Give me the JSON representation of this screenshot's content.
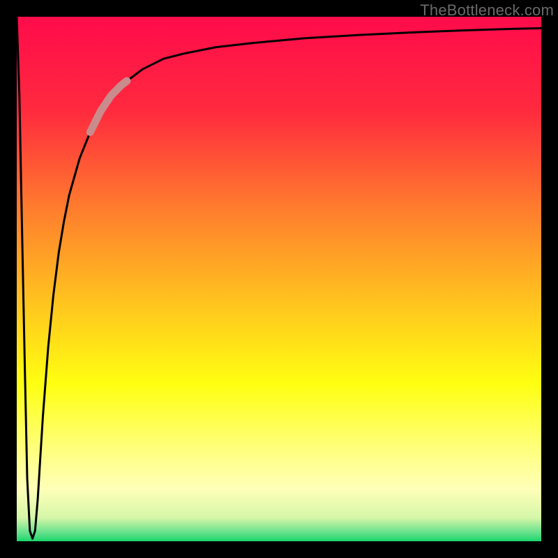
{
  "attribution": "TheBottleneck.com",
  "colors": {
    "frame": "#000000",
    "curve": "#000000",
    "highlight": "#c98b8b",
    "gradient_stops": [
      {
        "offset": 0.0,
        "color": "#ff0b4b"
      },
      {
        "offset": 0.18,
        "color": "#ff2a3e"
      },
      {
        "offset": 0.36,
        "color": "#ff7a2e"
      },
      {
        "offset": 0.54,
        "color": "#ffc21f"
      },
      {
        "offset": 0.7,
        "color": "#ffff11"
      },
      {
        "offset": 0.82,
        "color": "#ffff7a"
      },
      {
        "offset": 0.9,
        "color": "#ffffb8"
      },
      {
        "offset": 0.955,
        "color": "#d6f7a8"
      },
      {
        "offset": 0.985,
        "color": "#5fe08a"
      },
      {
        "offset": 1.0,
        "color": "#1ad66a"
      }
    ]
  },
  "chart_data": {
    "type": "line",
    "title": "",
    "xlabel": "",
    "ylabel": "",
    "xlim": [
      0,
      100
    ],
    "ylim": [
      0,
      100
    ],
    "series": [
      {
        "name": "bottleneck-curve",
        "x": [
          0.0,
          0.5,
          1.0,
          1.5,
          2.0,
          2.5,
          3.0,
          3.5,
          4.0,
          4.5,
          5.0,
          6.0,
          7.0,
          8.0,
          9.0,
          10.0,
          12.0,
          14.0,
          16.0,
          18.0,
          20.0,
          24.0,
          28.0,
          32.0,
          38.0,
          45.0,
          55.0,
          65.0,
          75.0,
          85.0,
          95.0,
          100.0
        ],
        "y": [
          100.0,
          85.0,
          60.0,
          35.0,
          12.0,
          2.0,
          0.5,
          2.0,
          8.0,
          16.0,
          24.0,
          37.0,
          47.0,
          55.0,
          61.0,
          66.0,
          73.0,
          78.0,
          82.0,
          85.0,
          87.0,
          90.0,
          92.0,
          93.0,
          94.2,
          95.0,
          95.9,
          96.5,
          97.0,
          97.4,
          97.7,
          97.8
        ]
      }
    ],
    "highlight_range_x": [
      14.0,
      21.0
    ],
    "optimum_x": 3.0
  }
}
